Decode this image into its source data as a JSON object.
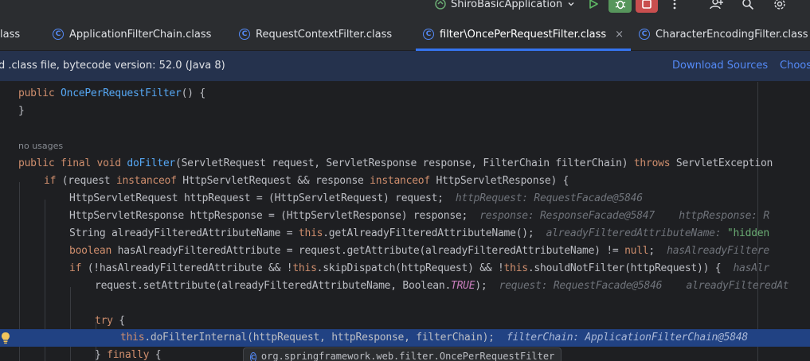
{
  "toolbar": {
    "run_config": "ShiroBasicApplication",
    "run_icon": "run-icon",
    "debug_icon": "debug-icon",
    "stop_icon": "stop-icon",
    "more_icon": "more-vertical-icon",
    "add_user_icon": "add-user-icon",
    "search_icon": "search-icon",
    "settings_icon": "settings-icon"
  },
  "tabs": [
    {
      "label": "lass"
    },
    {
      "label": "ApplicationFilterChain.class"
    },
    {
      "label": "RequestContextFilter.class"
    },
    {
      "label": "filter\\OncePerRequestFilter.class",
      "active": true
    },
    {
      "label": "CharacterEncodingFilter.class"
    }
  ],
  "tab_close": "×",
  "banner": {
    "message": "d .class file, bytecode version: 52.0 (Java 8)",
    "download_sources": "Download Sources",
    "choose_sources": "Choos"
  },
  "code": {
    "l1": {
      "kw": "public",
      "fn": "OncePerRequestFilter",
      "rest": "() {"
    },
    "l2": "}",
    "usages": "no usages",
    "l4": {
      "a": "public final void ",
      "fn": "doFilter",
      "b": "(ServletRequest request, ServletResponse response, FilterChain filterChain) ",
      "kw": "throws",
      "c": " ServletException"
    },
    "l5": {
      "kw": "if",
      "a": " (request ",
      "kw2": "instanceof",
      "b": " HttpServletRequest && response ",
      "kw3": "instanceof",
      "c": " HttpServletResponse) {"
    },
    "l6": {
      "code": "HttpServletRequest httpRequest = (HttpServletRequest) request;",
      "hint": "httpRequest: RequestFacade@5846"
    },
    "l7": {
      "code": "HttpServletResponse httpResponse = (HttpServletResponse) response;",
      "hint1": "response: ResponseFacade@5847",
      "hint2": "httpResponse: R"
    },
    "l8": {
      "a": "String alreadyFilteredAttributeName = ",
      "kw": "this",
      "b": ".getAlreadyFilteredAttributeName();",
      "hint": "alreadyFilteredAttributeName: ",
      "hint_str": "\"hidden"
    },
    "l9": {
      "kw": "boolean",
      "a": " hasAlreadyFilteredAttribute = request.getAttribute(alreadyFilteredAttributeName) != ",
      "kw2": "null",
      "b": ";",
      "hint": "hasAlreadyFiltere"
    },
    "l10": {
      "kw": "if",
      "a": " (!hasAlreadyFilteredAttribute && !",
      "kw2": "this",
      "b": ".skipDispatch(httpRequest) && !",
      "kw3": "this",
      "c": ".shouldNotFilter(httpRequest)) {",
      "hint": "hasAlr"
    },
    "l11": {
      "a": "request.setAttribute(alreadyFilteredAttributeName, Boolean.",
      "const": "TRUE",
      "b": ");",
      "hint1": "request: RequestFacade@5846",
      "hint2": "alreadyFilteredAt"
    },
    "l13": {
      "kw": "try",
      "a": " {"
    },
    "l14": {
      "kw": "this",
      "a": ".doFilterInternal(httpRequest, httpResponse, filterChain);",
      "hint": "filterChain: ApplicationFilterChain@5848"
    },
    "l15": {
      "a": "} ",
      "kw": "finally",
      "b": " {"
    }
  },
  "popup": {
    "text": "org.springframework.web.filter.OncePerRequestFilter"
  }
}
